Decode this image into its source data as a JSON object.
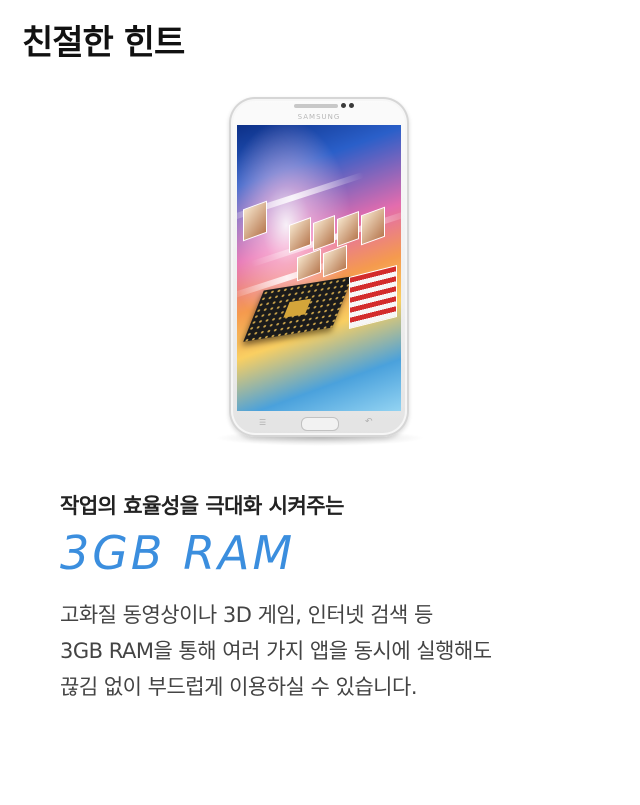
{
  "page": {
    "title": "친절한 힌트"
  },
  "phone": {
    "brand": "SAMSUNG",
    "menu_icon": "menu-icon",
    "back_icon": "back-icon"
  },
  "feature": {
    "subtitle": "작업의 효율성을 극대화 시켜주는",
    "headline": "3GB RAM",
    "description_lines": [
      "고화질 동영상이나 3D 게임, 인터넷 검색 등",
      "3GB RAM을 통해 여러 가지 앱을 동시에 실행해도",
      "끊김 없이 부드럽게 이용하실 수 있습니다."
    ]
  },
  "colors": {
    "headline": "#3b8ede",
    "text": "#444444",
    "title": "#111111"
  }
}
